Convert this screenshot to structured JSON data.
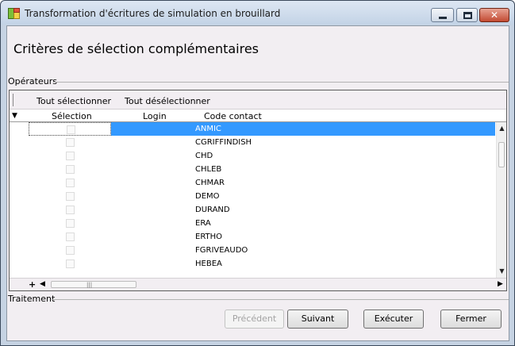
{
  "window": {
    "title": "Transformation d'écritures de simulation en brouillard",
    "close_glyph": "✕"
  },
  "heading": "Critères de sélection complémentaires",
  "operators_group": {
    "label": "Opérateurs",
    "toolbar": {
      "select_all": "Tout sélectionner",
      "deselect_all": "Tout désélectionner"
    },
    "columns": {
      "arrow": "▼",
      "selection": "Sélection",
      "login": "Login",
      "code_contact": "Code contact"
    },
    "rows": [
      {
        "code": "ANMIC",
        "selected": false
      },
      {
        "code": "CGRIFFINDISH",
        "selected": false
      },
      {
        "code": "CHD",
        "selected": false
      },
      {
        "code": "CHLEB",
        "selected": false
      },
      {
        "code": "CHMAR",
        "selected": false
      },
      {
        "code": "DEMO",
        "selected": false
      },
      {
        "code": "DURAND",
        "selected": false
      },
      {
        "code": "ERA",
        "selected": false
      },
      {
        "code": "ERTHO",
        "selected": false
      },
      {
        "code": "FGRIVEAUDO",
        "selected": false
      },
      {
        "code": "HEBEA",
        "selected": false
      }
    ],
    "highlighted_row": 0,
    "add_row_glyph": "+",
    "scroll_glyphs": {
      "up": "▲",
      "down": "▼",
      "left": "◀",
      "right": "▶",
      "grip": "|||"
    }
  },
  "treatment_group": {
    "label": "Traitement"
  },
  "buttons": {
    "previous": "Précédent",
    "next": "Suivant",
    "execute": "Exécuter",
    "close": "Fermer"
  }
}
